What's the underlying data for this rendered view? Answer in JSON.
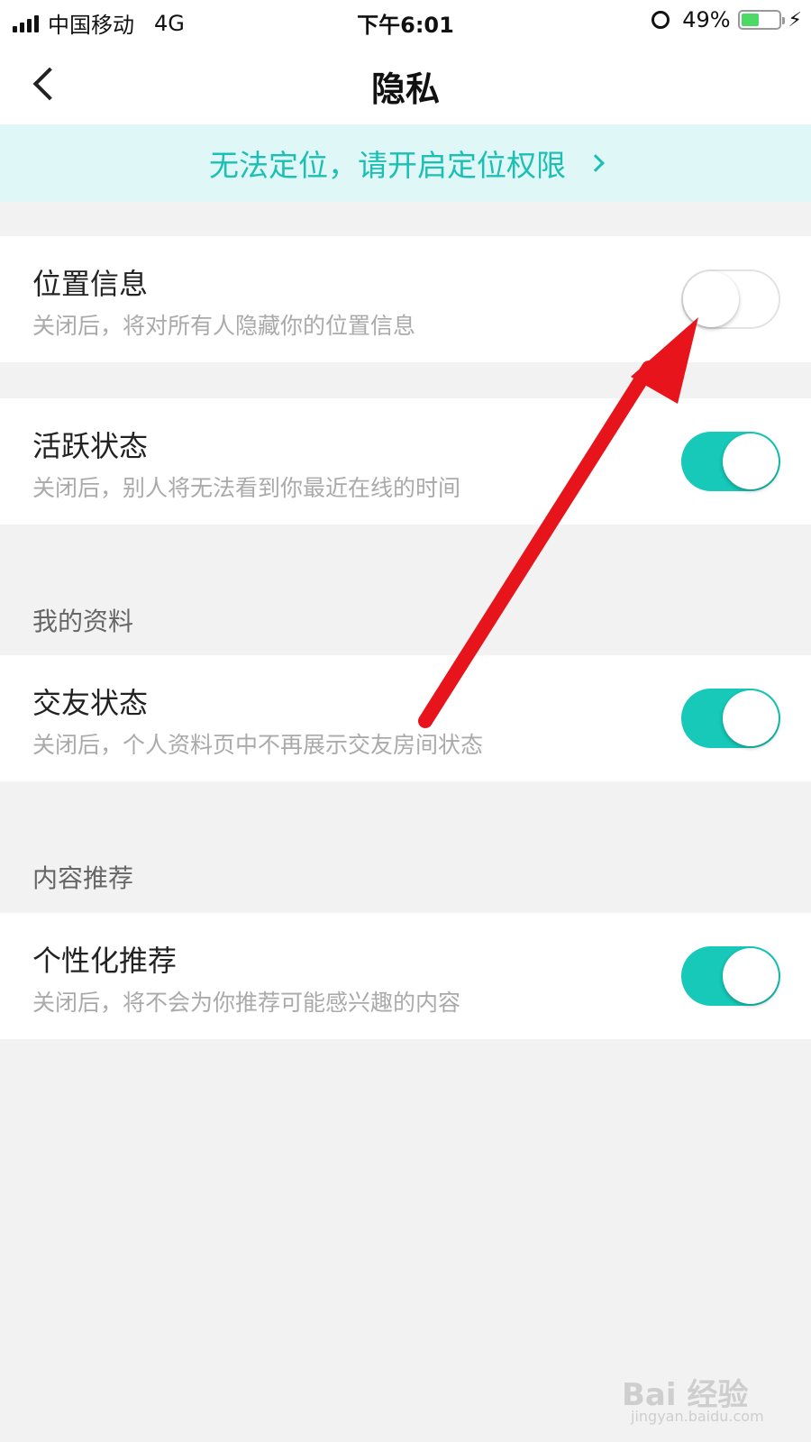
{
  "status_bar": {
    "carrier": "中国移动",
    "network": "4G",
    "time": "下午6:01",
    "battery_percent": "49%",
    "battery_level": 0.49,
    "battery_color": "#4cd964"
  },
  "nav": {
    "back_icon": "chevron-left-icon",
    "title": "隐私"
  },
  "banner": {
    "text": "无法定位，请开启定位权限",
    "color": "#1cbfb3",
    "background": "#dff7f6",
    "icon": "chevron-right-icon"
  },
  "settings": [
    {
      "title": "位置信息",
      "subtitle": "关闭后，将对所有人隐藏你的位置信息",
      "enabled": false
    },
    {
      "title": "活跃状态",
      "subtitle": "关闭后，别人将无法看到你最近在线的时间",
      "enabled": true
    }
  ],
  "sections": [
    {
      "label": "我的资料",
      "items": [
        {
          "title": "交友状态",
          "subtitle": "关闭后，个人资料页中不再展示交友房间状态",
          "enabled": true
        }
      ]
    },
    {
      "label": "内容推荐",
      "items": [
        {
          "title": "个性化推荐",
          "subtitle": "关闭后，将不会为你推荐可能感兴趣的内容",
          "enabled": true
        }
      ]
    }
  ],
  "accent_color": "#16c9b8",
  "annotation_arrow_color": "#e8141c",
  "watermark": {
    "main": "Bai 经验",
    "sub": "jingyan.baidu.com"
  }
}
